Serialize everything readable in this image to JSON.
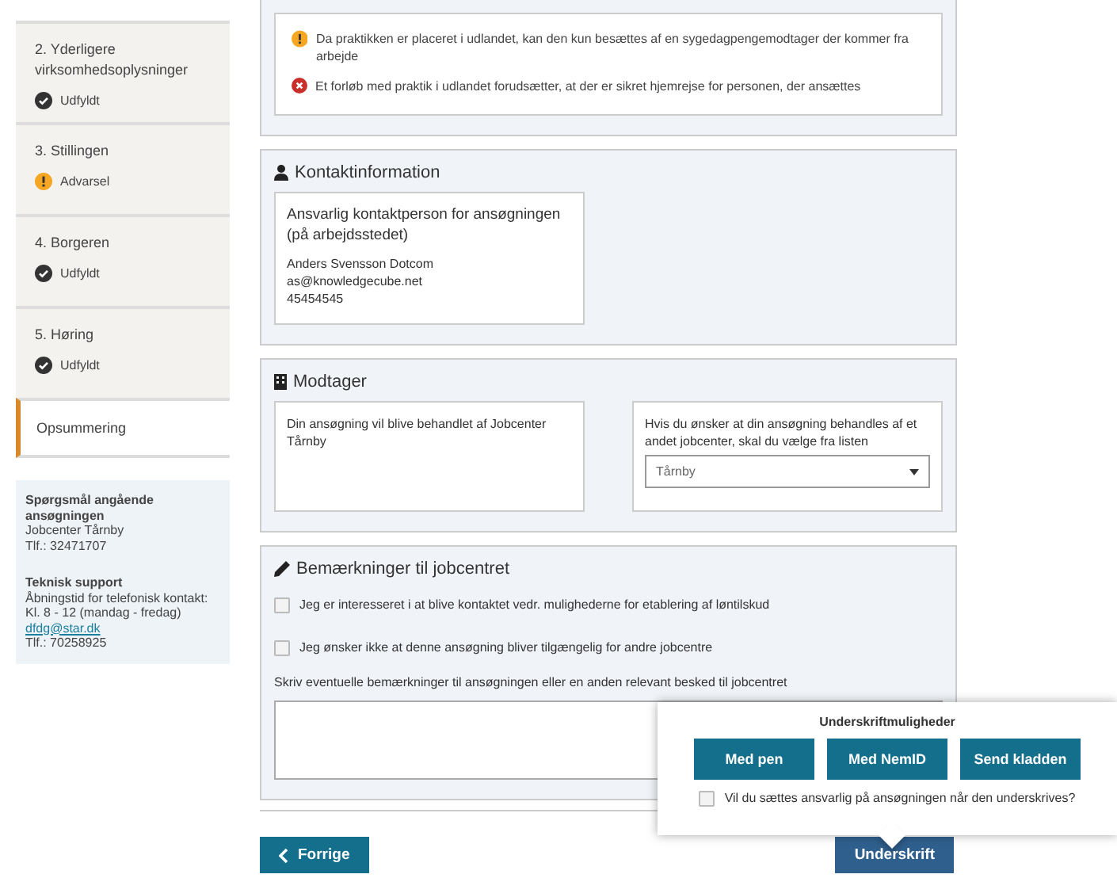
{
  "sidebar": {
    "steps": [
      {
        "title": "2. Yderligere virksomhedsoplysninger",
        "status": "Udfyldt",
        "kind": "done"
      },
      {
        "title": "3. Stillingen",
        "status": "Advarsel",
        "kind": "warning"
      },
      {
        "title": "4. Borgeren",
        "status": "Udfyldt",
        "kind": "done"
      },
      {
        "title": "5. Høring",
        "status": "Udfyldt",
        "kind": "done"
      }
    ],
    "current": {
      "title": "Opsummering",
      "selected": true
    },
    "support": [
      {
        "heading": "Spørgsmål angående ansøgningen",
        "lines": [
          "Jobcenter Tårnby",
          "Tlf.: 32471707"
        ]
      },
      {
        "heading": "Teknisk support",
        "lines": [
          "Åbningstid for telefonisk kontakt:",
          "Kl. 8 - 12 (mandag - fredag)"
        ],
        "link": "dfdg@star.dk",
        "after": [
          "Tlf.: 70258925"
        ]
      }
    ]
  },
  "messages": [
    {
      "kind": "warning",
      "text": "Da praktikken er placeret i udlandet, kan den kun besættes af en sygedagpengemodtager der kommer fra arbejde"
    },
    {
      "kind": "error",
      "text": "Et forløb med praktik i udlandet forudsætter, at der er sikret hjemrejse for personen, der ansættes"
    }
  ],
  "contact": {
    "title": "Kontaktinformation",
    "card_title": "Ansvarlig kontaktperson for ansøgningen (på arbejdsstedet)",
    "lines": [
      "Anders Svensson Dotcom",
      "as@knowledgecube.net",
      "45454545"
    ]
  },
  "recipient": {
    "title": "Modtager",
    "info": "Din ansøgning vil blive behandlet af Jobcenter Tårnby",
    "select_label": "Hvis du ønsker at din ansøgning behandles af et andet jobcenter, skal du vælge fra listen",
    "select_value": "Tårnby"
  },
  "remarks": {
    "title": "Bemærkninger til jobcentret",
    "checkboxes": [
      {
        "label": "Jeg er interesseret i at blive kontaktet vedr. mulighederne for etablering af løntilskud",
        "checked": false
      },
      {
        "label": "Jeg ønsker ikke at denne ansøgning bliver tilgængelig for andre jobcentre",
        "checked": false
      }
    ],
    "textarea_label": "Skriv eventuelle bemærkninger til ansøgningen eller en anden relevant besked til jobcentret"
  },
  "popover": {
    "title": "Underskriftmuligheder",
    "buttons": [
      "Med pen",
      "Med NemID",
      "Send kladden"
    ],
    "checkbox": {
      "label": "Vil du sættes ansvarlig på ansøgningen når den underskrives?",
      "checked": false
    }
  },
  "footer": {
    "back": "Forrige",
    "sign": "Underskrift"
  }
}
